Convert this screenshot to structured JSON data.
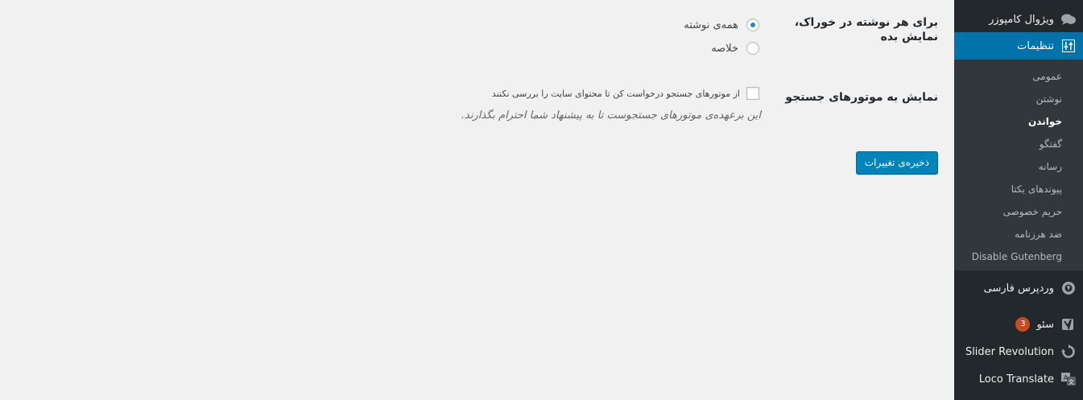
{
  "sidebar": {
    "visual_composer": "ویژوال کامپوزر",
    "settings": "تنظیمات",
    "submenu": [
      "عمومی",
      "نوشتن",
      "خواندن",
      "گفتگو",
      "رسانه",
      "پیوندهای یکتا",
      "حریم خصوصی",
      "ضد هرزنامه",
      "Disable Gutenberg"
    ],
    "current_submenu_index": 2,
    "wp_farsi": "وردپرس فارسی",
    "seo": "سئو",
    "seo_badge": "3",
    "slider_revolution": "Slider Revolution",
    "loco_translate": "Loco Translate"
  },
  "icons": {
    "visual_composer": "chat-bubbles-icon",
    "settings": "sliders-icon",
    "wp_farsi": "wordpress-farsi-icon",
    "seo": "yoast-icon",
    "slider_revolution": "refresh-icon",
    "loco_translate": "translate-icon"
  },
  "colors": {
    "sidebar_bg": "#23282d",
    "submenu_bg": "#32373c",
    "active": "#0073aa",
    "badge": "#ca4a1f",
    "button": "#0085ba"
  },
  "form": {
    "feed_label": "برای هر نوشته در خوراک، نمایش بده",
    "feed_options": [
      {
        "label": "همه‌ی نوشته",
        "checked": true
      },
      {
        "label": "خلاصه",
        "checked": false
      }
    ],
    "search_label": "نمایش به موتورهای جستجو",
    "noindex_label": "از موتورهای جستجو درخواست کن تا محتوای سایت را بررسی نکنند",
    "noindex_checked": false,
    "description": "این برعهده‌ی موتورهای جستجوست تا به پیشنهاد شما احترام بگذارند.",
    "save_button": "ذخیره‌ی تغییرات"
  }
}
